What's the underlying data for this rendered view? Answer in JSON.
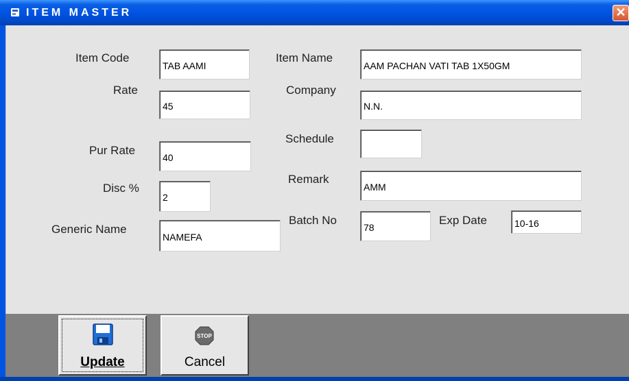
{
  "window": {
    "title": "ITEM MASTER",
    "close_glyph": "✕"
  },
  "form": {
    "item_code": {
      "label": "Item Code",
      "value": "TAB AAMI"
    },
    "item_name": {
      "label": "Item Name",
      "value": "AAM PACHAN VATI TAB 1X50GM"
    },
    "rate": {
      "label": "Rate",
      "value": "45"
    },
    "company": {
      "label": "Company",
      "value": "N.N."
    },
    "schedule": {
      "label": "Schedule",
      "value": ""
    },
    "pur_rate": {
      "label": "Pur Rate",
      "value": "40"
    },
    "disc": {
      "label": "Disc %",
      "value": "2"
    },
    "remark": {
      "label": "Remark",
      "value": "AMM"
    },
    "generic_name": {
      "label": "Generic Name",
      "value": "NAMEFA"
    },
    "batch_no": {
      "label": "Batch No",
      "value": "78"
    },
    "exp_date": {
      "label": "Exp Date",
      "value": "10-16"
    }
  },
  "toolbar": {
    "update_label": "Update",
    "cancel_label": "Cancel",
    "update_icon": "floppy-disk-icon",
    "cancel_icon": "stop-sign-icon",
    "stop_text": "STOP"
  },
  "colors": {
    "titlebar": "#0054E3",
    "form_background": "#E4E4E4",
    "toolbar_background": "#808080",
    "close_button": "#D9532F"
  }
}
